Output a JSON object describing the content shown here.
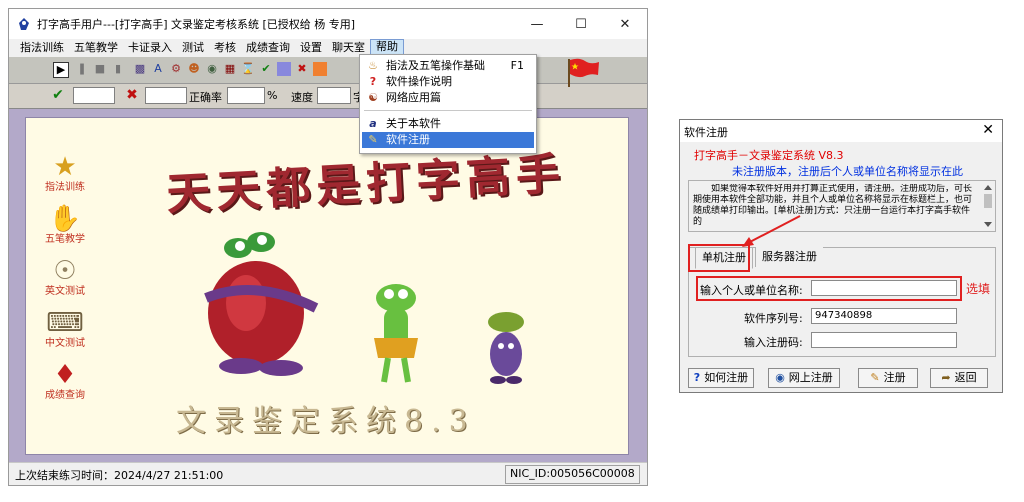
{
  "main_window": {
    "title": "打字高手用户---[打字高手]    文录鉴定考核系统  [已授权给 杨 专用]",
    "menu": [
      "指法训练",
      "五笔教学",
      "卡证录入",
      "测试",
      "考核",
      "成绩查询",
      "设置",
      "聊天室",
      "帮助"
    ],
    "toolbar2": {
      "accuracy_label": "正确率",
      "percent": "%",
      "speed_label": "速度",
      "char_label": "字"
    },
    "sidebar": [
      {
        "label": "指法训练",
        "icon": "star-icon"
      },
      {
        "label": "五笔教学",
        "icon": "hand-icon"
      },
      {
        "label": "英文测试",
        "icon": "shell-icon"
      },
      {
        "label": "中文测试",
        "icon": "keyboard-icon"
      },
      {
        "label": "成绩查询",
        "icon": "gift-icon"
      }
    ],
    "banner_title": "天天都是打字高手",
    "bottom_title": "文录鉴定系统8.3",
    "status_left": "上次结束练习时间：2024/4/27  21:51:00",
    "status_right": "NIC_ID:005056C00008"
  },
  "help_menu": {
    "items": [
      {
        "label": "指法及五笔操作基础",
        "shortcut": "F1",
        "icon": "bell-icon"
      },
      {
        "label": "软件操作说明",
        "shortcut": "",
        "icon": "question-icon"
      },
      {
        "label": "网络应用篇",
        "shortcut": "",
        "icon": "network-icon"
      },
      {
        "label": "关于本软件",
        "shortcut": "",
        "icon": "about-icon"
      },
      {
        "label": "软件注册",
        "shortcut": "",
        "icon": "register-icon"
      }
    ]
  },
  "register_dialog": {
    "title": "软件注册",
    "heading": "打字高手－文录鉴定系统 V8.3",
    "subheading": "未注册版本，注册后个人或单位名称将显示在此",
    "info_text": "如果觉得本软件好用并打算正式使用，请注册。注册成功后，可长期使用本软件全部功能，并且个人或单位名称将显示在标题栏上，也可随成绩单打印输出。[单机注册]方式：只注册一台运行本打字高手软件的",
    "tabs": [
      "单机注册",
      "服务器注册"
    ],
    "name_label": "输入个人或单位名称:",
    "name_value": "",
    "serial_label": "软件序列号:",
    "serial_value": "947340898",
    "code_label": "输入注册码:",
    "code_value": "",
    "annotation": "选填",
    "buttons": [
      "如何注册",
      "网上注册",
      "注册",
      "返回"
    ]
  }
}
